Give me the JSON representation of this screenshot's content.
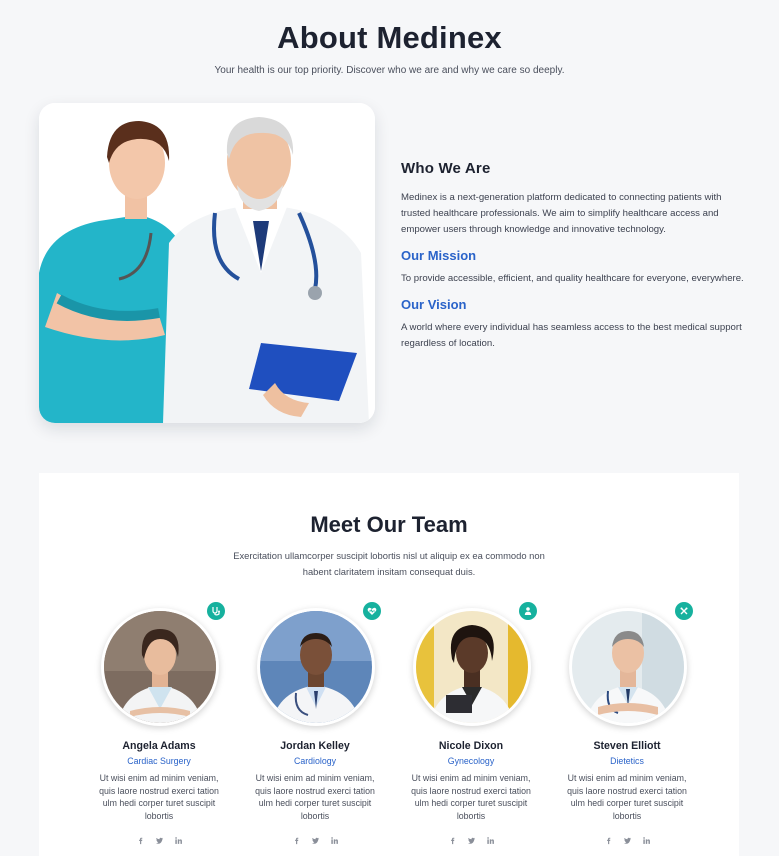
{
  "hero": {
    "title": "About Medinex",
    "subtitle": "Your health is our top priority. Discover who we are and why we care so deeply."
  },
  "about": {
    "who_title": "Who We Are",
    "who_text": "Medinex is a next-generation platform dedicated to connecting patients with trusted healthcare professionals. We aim to simplify healthcare access and empower users through knowledge and innovative technology.",
    "mission_title": "Our Mission",
    "mission_text": "To provide accessible, efficient, and quality healthcare for everyone, everywhere.",
    "vision_title": "Our Vision",
    "vision_text": "A world where every individual has seamless access to the best medical support regardless of location."
  },
  "team": {
    "title": "Meet Our Team",
    "description": "Exercitation ullamcorper suscipit lobortis nisl ut aliquip ex ea commodo non habent claritatem insitam consequat duis.",
    "members": [
      {
        "name": "Angela Adams",
        "role": "Cardiac Surgery",
        "bio": "Ut wisi enim ad minim veniam, quis laore nostrud exerci tation ulm hedi corper turet suscipit lobortis",
        "badge_icon": "stethoscope-icon"
      },
      {
        "name": "Jordan Kelley",
        "role": "Cardiology",
        "bio": "Ut wisi enim ad minim veniam, quis laore nostrud exerci tation ulm hedi corper turet suscipit lobortis",
        "badge_icon": "heart-pulse-icon"
      },
      {
        "name": "Nicole Dixon",
        "role": "Gynecology",
        "bio": "Ut wisi enim ad minim veniam, quis laore nostrud exerci tation ulm hedi corper turet suscipit lobortis",
        "badge_icon": "doctor-icon"
      },
      {
        "name": "Steven Elliott",
        "role": "Dietetics",
        "bio": "Ut wisi enim ad minim veniam, quis laore nostrud exerci tation ulm hedi corper turet suscipit lobortis",
        "badge_icon": "cutlery-icon"
      }
    ],
    "social_icons": [
      "facebook-icon",
      "twitter-icon",
      "linkedin-icon"
    ]
  },
  "colors": {
    "accent_blue": "#2a63c9",
    "badge_teal": "#16b19e",
    "heading": "#1d2230",
    "background": "#f6f7f9"
  }
}
